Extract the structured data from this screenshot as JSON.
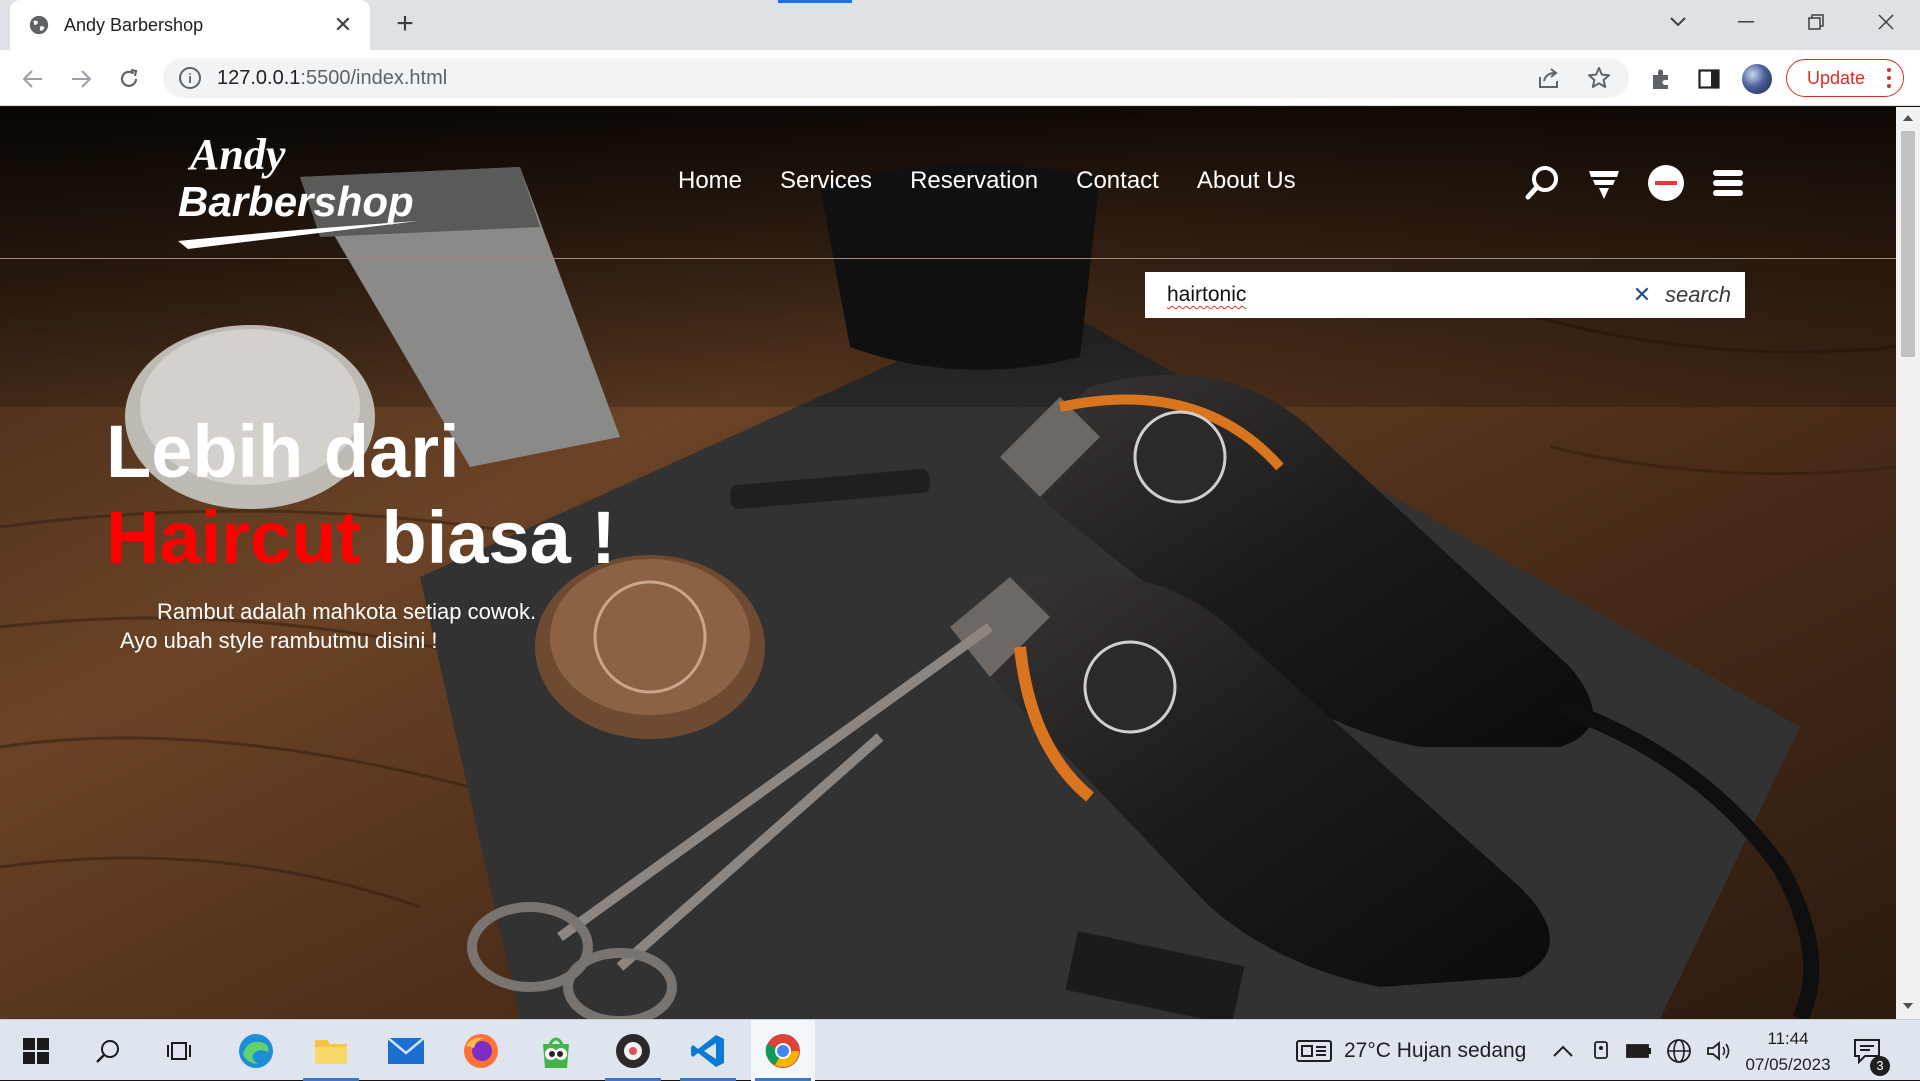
{
  "browser": {
    "tab_title": "Andy Barbershop",
    "url_host": "127.0.0.1",
    "url_rest": ":5500/index.html",
    "update_label": "Update"
  },
  "site": {
    "logo_line1": "Andy",
    "logo_line2": "Barbershop",
    "nav": [
      "Home",
      "Services",
      "Reservation",
      "Contact",
      "About Us"
    ],
    "search": {
      "value": "hairtonic",
      "button_label": "search"
    },
    "hero": {
      "title_line1": "Lebih dari",
      "title_highlight": "Haircut",
      "title_rest": " biasa !",
      "subtitle_line1": "Rambut adalah mahkota setiap cowok.",
      "subtitle_line2": "Ayo ubah style rambutmu disini !"
    },
    "accent_color": "#ff0000"
  },
  "taskbar": {
    "weather": "27°C  Hujan sedang",
    "time": "11:44",
    "date": "07/05/2023",
    "notification_count": "3"
  }
}
